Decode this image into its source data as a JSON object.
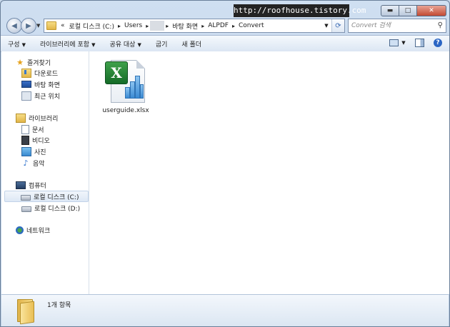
{
  "watermark": "http://roofhouse.tistory.com",
  "window": {
    "minimize_glyph": "▬",
    "maximize_glyph": "□",
    "close_glyph": "✕"
  },
  "address": {
    "prefix": "«",
    "crumbs": [
      "로컬 디스크 (C:)",
      "Users",
      "",
      "바탕 화면",
      "ALPDF",
      "Convert"
    ],
    "separator": "▸"
  },
  "search": {
    "placeholder": "Convert 검색"
  },
  "toolbar": {
    "organize": "구성",
    "include_library": "라이브러리에 포함",
    "share": "공유 대상",
    "burn": "굽기",
    "new_folder": "새 폴더"
  },
  "sidebar": {
    "favorites": "즐겨찾기",
    "downloads": "다운로드",
    "desktop": "바탕 화면",
    "recent": "최근 위치",
    "libraries": "라이브러리",
    "documents": "문서",
    "videos": "비디오",
    "pictures": "사진",
    "music": "음악",
    "computer": "컴퓨터",
    "drive_c": "로컬 디스크 (C:)",
    "drive_d": "로컬 디스크 (D:)",
    "network": "네트워크"
  },
  "files": [
    {
      "name": "userguide.xlsx",
      "icon": "excel-file-icon"
    }
  ],
  "status": {
    "count": "1개 항목"
  },
  "colors": {
    "accent": "#2b66c4",
    "excel_green": "#1e7b34",
    "folder_yellow": "#e9bf55"
  }
}
